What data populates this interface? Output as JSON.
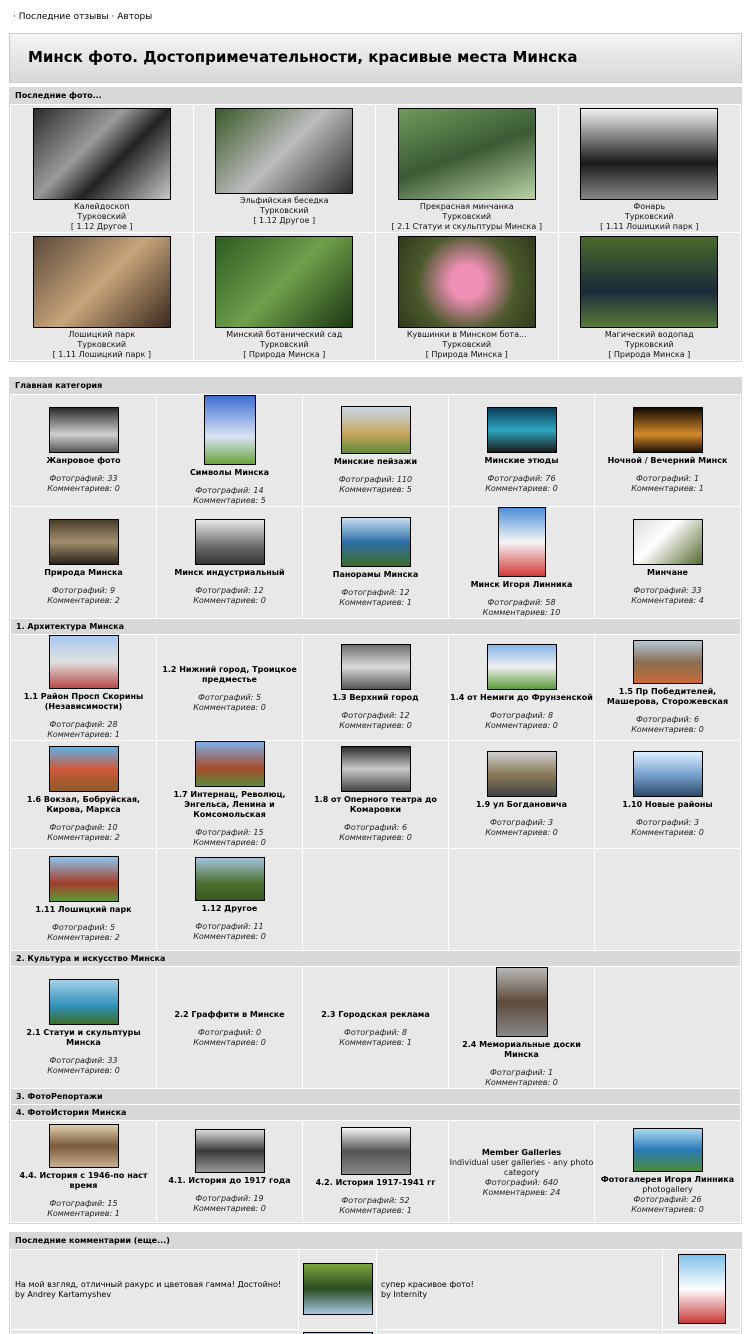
{
  "topnav": {
    "link1": "Последние отзывы",
    "link2": "Авторы"
  },
  "banner": {
    "title": "Минск фото. Достопримечательности, красивые места Минска"
  },
  "latest_photos": {
    "title": "Последние фото...",
    "rows": [
      [
        {
          "name": "Калейдоскоп",
          "author": "Турковский",
          "cat": "[ 1.12 Другое ]"
        },
        {
          "name": "Эльфийская беседка",
          "author": "Турковский",
          "cat": "[ 1.12 Другое ]"
        },
        {
          "name": "Прекрасная минчанка",
          "author": "Турковский",
          "cat": "[ 2.1 Статуи и скульптуры Минска ]"
        },
        {
          "name": "Фонарь",
          "author": "Турковский",
          "cat": "[ 1.11 Лошицкий парк ]"
        }
      ],
      [
        {
          "name": "Лошицкий парк",
          "author": "Турковский",
          "cat": "[ 1.11 Лошицкий парк ]"
        },
        {
          "name": "Минский ботанический сад",
          "author": "Турковский",
          "cat": "[ Природа Минска ]"
        },
        {
          "name": "Кувшинки в Минском бота...",
          "author": "Турковский",
          "cat": "[ Природа Минска ]"
        },
        {
          "name": "Магический водопад",
          "author": "Турковский",
          "cat": "[ Природа Минска ]"
        }
      ]
    ]
  },
  "categories": {
    "title": "Главная категория",
    "main_rows": [
      [
        {
          "name": "Жанровое фото",
          "photos": "Фотографий: 33",
          "comments": "Комментариев: 0"
        },
        {
          "name": "Символы Минска",
          "photos": "Фотографий: 14",
          "comments": "Комментариев: 5"
        },
        {
          "name": "Минские пейзажи",
          "photos": "Фотографий: 110",
          "comments": "Комментариев: 5"
        },
        {
          "name": "Минские этюды",
          "photos": "Фотографий: 76",
          "comments": "Комментариев: 0"
        },
        {
          "name": "Ночной / Вечерний Минск",
          "photos": "Фотографий: 1",
          "comments": "Комментариев: 1"
        }
      ],
      [
        {
          "name": "Природа Минска",
          "photos": "Фотографий: 9",
          "comments": "Комментариев: 2"
        },
        {
          "name": "Минск индустриальный",
          "photos": "Фотографий: 12",
          "comments": "Комментариев: 0"
        },
        {
          "name": "Панорамы Минска",
          "photos": "Фотографий: 12",
          "comments": "Комментариев: 1"
        },
        {
          "name": "Минск Игоря Линника",
          "photos": "Фотографий: 58",
          "comments": "Комментариев: 10"
        },
        {
          "name": "Минчане",
          "photos": "Фотографий: 33",
          "comments": "Комментариев: 4"
        }
      ]
    ],
    "sec1": {
      "title": "1. Архитектура Минска",
      "rows": [
        [
          {
            "name": "1.1 Район Просп Скорины (Независимости)",
            "photos": "Фотографий: 28",
            "comments": "Комментариев: 1"
          },
          {
            "name": "1.2 Нижний город, Троицкое предместье",
            "photos": "Фотографий: 5",
            "comments": "Комментариев: 0"
          },
          {
            "name": "1.3 Верхний город",
            "photos": "Фотографий: 12",
            "comments": "Комментариев: 0"
          },
          {
            "name": "1.4 от Немиги до Фрунзенской",
            "photos": "Фотографий: 8",
            "comments": "Комментариев: 0"
          },
          {
            "name": "1.5 Пр Победителей, Машерова, Сторожевская",
            "photos": "Фотографий: 6",
            "comments": "Комментариев: 0"
          }
        ],
        [
          {
            "name": "1.6 Вокзал, Бобруйская, Кирова, Маркса",
            "photos": "Фотографий: 10",
            "comments": "Комментариев: 2"
          },
          {
            "name": "1.7 Интернац, Революц, Энгельса, Ленина и Комсомольская",
            "photos": "Фотографий: 15",
            "comments": "Комментариев: 0"
          },
          {
            "name": "1.8 от Оперного театра до Комаровки",
            "photos": "Фотографий: 6",
            "comments": "Комментариев: 0"
          },
          {
            "name": "1.9 ул Богдановича",
            "photos": "Фотографий: 3",
            "comments": "Комментариев: 0"
          },
          {
            "name": "1.10 Новые районы",
            "photos": "Фотографий: 3",
            "comments": "Комментариев: 0"
          }
        ],
        [
          {
            "name": "1.11 Лошицкий парк",
            "photos": "Фотографий: 5",
            "comments": "Комментариев: 2"
          },
          {
            "name": "1.12 Другое",
            "photos": "Фотографий: 11",
            "comments": "Комментариев: 0"
          }
        ]
      ]
    },
    "sec2": {
      "title": "2. Культура и искусство Минска",
      "row": [
        {
          "name": "2.1 Статуи и скульптуры Минска",
          "photos": "Фотографий: 33",
          "comments": "Комментариев: 0"
        },
        {
          "name": "2.2 Граффити в Минске",
          "photos": "Фотографий: 0",
          "comments": "Комментариев: 0"
        },
        {
          "name": "2.3 Городская реклама",
          "photos": "Фотографий: 8",
          "comments": "Комментариев: 1"
        },
        {
          "name": "2.4 Мемориальные доски Минска",
          "photos": "Фотографий: 1",
          "comments": "Комментариев: 0"
        }
      ]
    },
    "sec3": {
      "title": "3. ФотоРепортажи"
    },
    "sec4": {
      "title": "4. ФотоИстория Минска",
      "row": [
        {
          "name": "4.4. История с 1946-по наст время",
          "photos": "Фотографий: 15",
          "comments": "Комментариев: 1"
        },
        {
          "name": "4.1. История до 1917 года",
          "photos": "Фотографий: 19",
          "comments": "Комментариев: 0"
        },
        {
          "name": "4.2. История 1917-1941 гг",
          "photos": "Фотографий: 52",
          "comments": "Комментариев: 1"
        },
        {
          "name": "Member Galleries",
          "desc": "Individual user galleries - any photo category",
          "photos": "Фотографий: 640",
          "comments": "Комментариев: 24"
        },
        {
          "name": "Фотогалерея Игоря Линника",
          "desc": "photogallery",
          "photos": "Фотографий: 26",
          "comments": "Комментариев: 0"
        }
      ]
    }
  },
  "comments": {
    "title": "Последние комментарии (еще...)",
    "items": [
      {
        "text": "На мой взгляд, отличный ракурс и цветовая гамма! Достойно!",
        "by": "by Andrey Kartamyshev"
      },
      {
        "text": "супер красивое фото!",
        "by": "by Internity"
      }
    ]
  }
}
